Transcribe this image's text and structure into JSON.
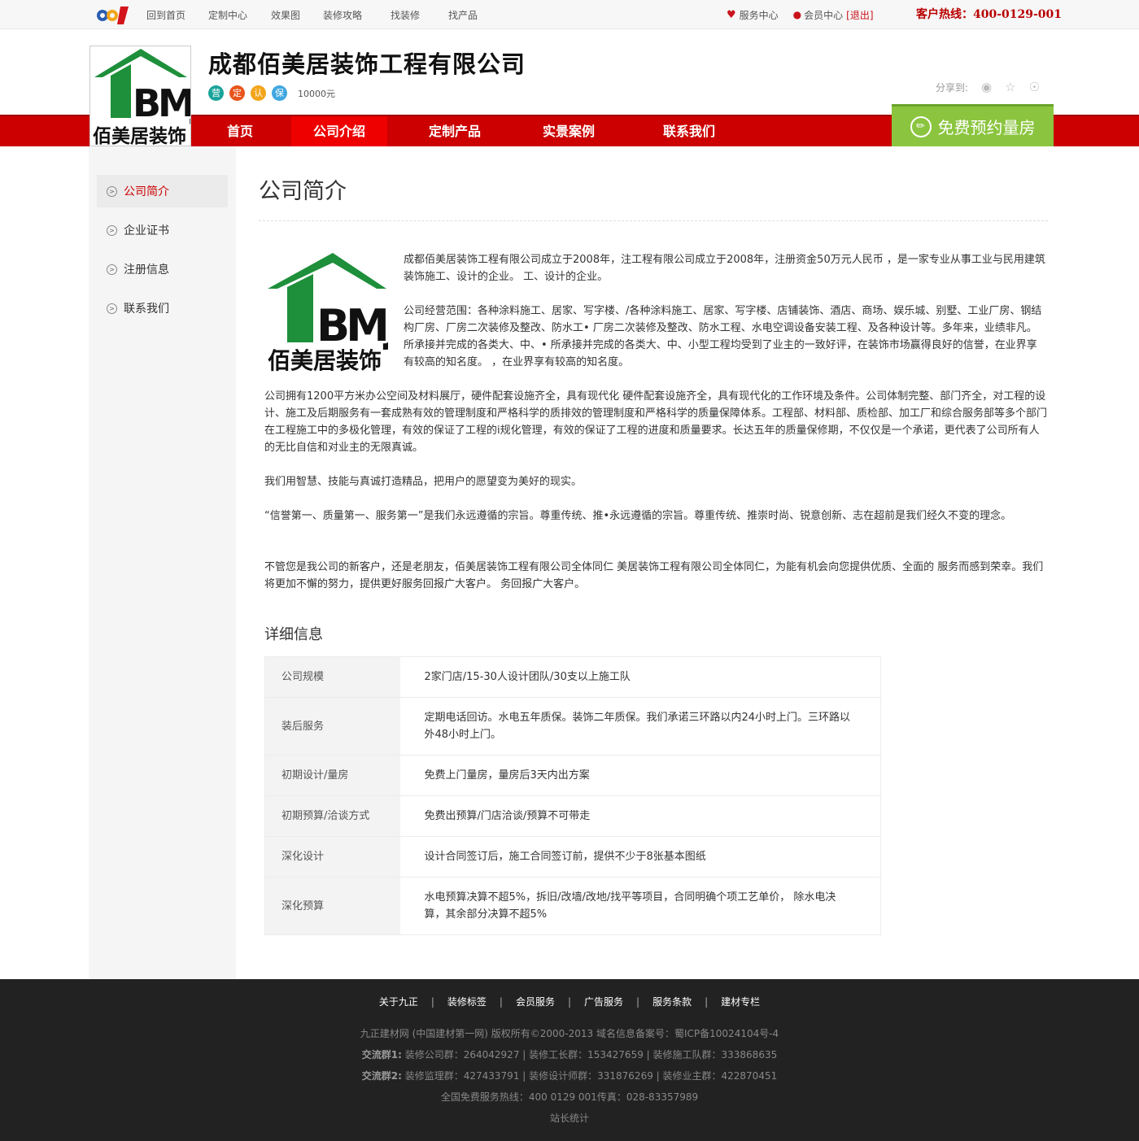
{
  "topbar": {
    "nav": [
      "回到首页",
      "定制中心",
      "效果图",
      "装修攻略",
      "找装修",
      "找产品"
    ],
    "service_center": "服务中心",
    "member_center": "会员中心",
    "logout": "[退出]",
    "hotline": "客户热线：400-0129-001"
  },
  "header": {
    "company_name": "成都佰美居装饰工程有限公司",
    "badges": [
      "营",
      "定",
      "认",
      "保"
    ],
    "capital": "10000元",
    "share_label": "分享到:",
    "logo_text_en": "BMJ",
    "logo_text_cn": "佰美居装饰"
  },
  "mainnav": {
    "items": [
      "首页",
      "公司介绍",
      "定制产品",
      "实景案例",
      "联系我们"
    ],
    "active_index": 1,
    "book_button": "免费预约量房"
  },
  "sidebar": {
    "items": [
      "公司简介",
      "企业证书",
      "注册信息",
      "联系我们"
    ],
    "active_index": 0
  },
  "main": {
    "title": "公司简介",
    "p1": "成都佰美居装饰工程有限公司成立于2008年，注工程有限公司成立于2008年，注册资金50万元人民币 ，是一家专业从事工业与民用建筑装饰施工、设计的企业。                     工、设计的企业。",
    "p2": "公司经营范围：各种涂料施工、居家、写字楼、/各种涂料施工、居家、写字楼、店铺装饰、酒店、商场、娱乐城、别墅、工业厂房、钢结构厂房、厂房二次装修及整改、防水工• 厂房二次装修及整改、防水工程、水电空调设备安装工程、及各种设计等。多年来，业绩非凡。所承接并完成的各类大、中、• 所承接并完成的各类大、中、小型工程均受到了业主的一致好评，在装饰市场赢得良好的信誉，在业界享有较高的知名度。   ，在业界享有较高的知名度。",
    "p3": "公司拥有1200平方米办公空间及材料展厅，硬件配套设施齐全，具有现代化 硬件配套设施齐全，具有现代化的工作环境及条件。公司体制完整、部门齐全，对工程的设计、施工及后期服务有一套成熟有效的管理制度和严格科学的质排效的管理制度和严格科学的质量保障体系。工程部、材料部、质检部、加工厂和综合服务部等多个部门在工程施工中的多极化管理，有效的保证了工程的i规化管理，有效的保证了工程的进度和质量要求。长达五年的质量保修期，不仅仅是一个承诺，更代表了公司所有人的无比自信和对业主的无限真诚。",
    "p4": "我们用智慧、技能与真诚打造精品，把用户的愿望变为美好的现实。",
    "p5": "“信誉第一、质量第一、服务第一”是我们永远遵循的宗旨。尊重传统、推•永远遵循的宗旨。尊重传统、推崇时尚、锐意创新、志在超前是我们经久不变的理念。",
    "p6": "不管您是我公司的新客户，还是老朋友，佰美居装饰工程有限公司全体同仁 美居装饰工程有限公司全体同仁，为能有机会向您提供优质、全面的 服务而感到荣幸。我们将更加不懈的努力，提供更好服务回报广大客户。                   务回报广大客户。",
    "details_title": "详细信息",
    "details": [
      {
        "key": "公司规模",
        "value": "2家门店/15-30人设计团队/30支以上施工队"
      },
      {
        "key": "装后服务",
        "value": "定期电话回访。水电五年质保。装饰二年质保。我们承诺三环路以内24小时上门。三环路以外48小时上门。"
      },
      {
        "key": "初期设计/量房",
        "value": "免费上门量房，量房后3天内出方案"
      },
      {
        "key": "初期预算/洽谈方式",
        "value": "免费出预算/门店洽谈/预算不可带走"
      },
      {
        "key": "深化设计",
        "value": "设计合同签订后，施工合同签订前，提供不少于8张基本图纸"
      },
      {
        "key": "深化预算",
        "value": "水电预算决算不超5%，拆旧/改墙/改地/找平等项目，合同明确个项工艺单价， 除水电决算，其余部分决算不超5%"
      }
    ]
  },
  "footer": {
    "links": [
      "关于九正",
      "装修标签",
      "会员服务",
      "广告服务",
      "服务条款",
      "建材专栏"
    ],
    "copyright": "九正建材网 (中国建材第一网) 版权所有©2000-2013  域名信息备案号：蜀ICP备10024104号-4",
    "group1_label": "交流群1:",
    "group1": " 装修公司群：264042927 | 装修工长群：153427659 | 装修施工队群：333868635",
    "group2_label": "交流群2:",
    "group2": " 装修监理群：427433791 | 装修设计师群：331876269 | 装修业主群：422870451",
    "hotline": "全国免费服务热线：400 0129 001传真：028-83357989",
    "stats": "站长统计"
  },
  "colors": {
    "brand_red": "#cc0000",
    "book_green": "#8bc53f",
    "logo_green": "#1e8f3a"
  }
}
